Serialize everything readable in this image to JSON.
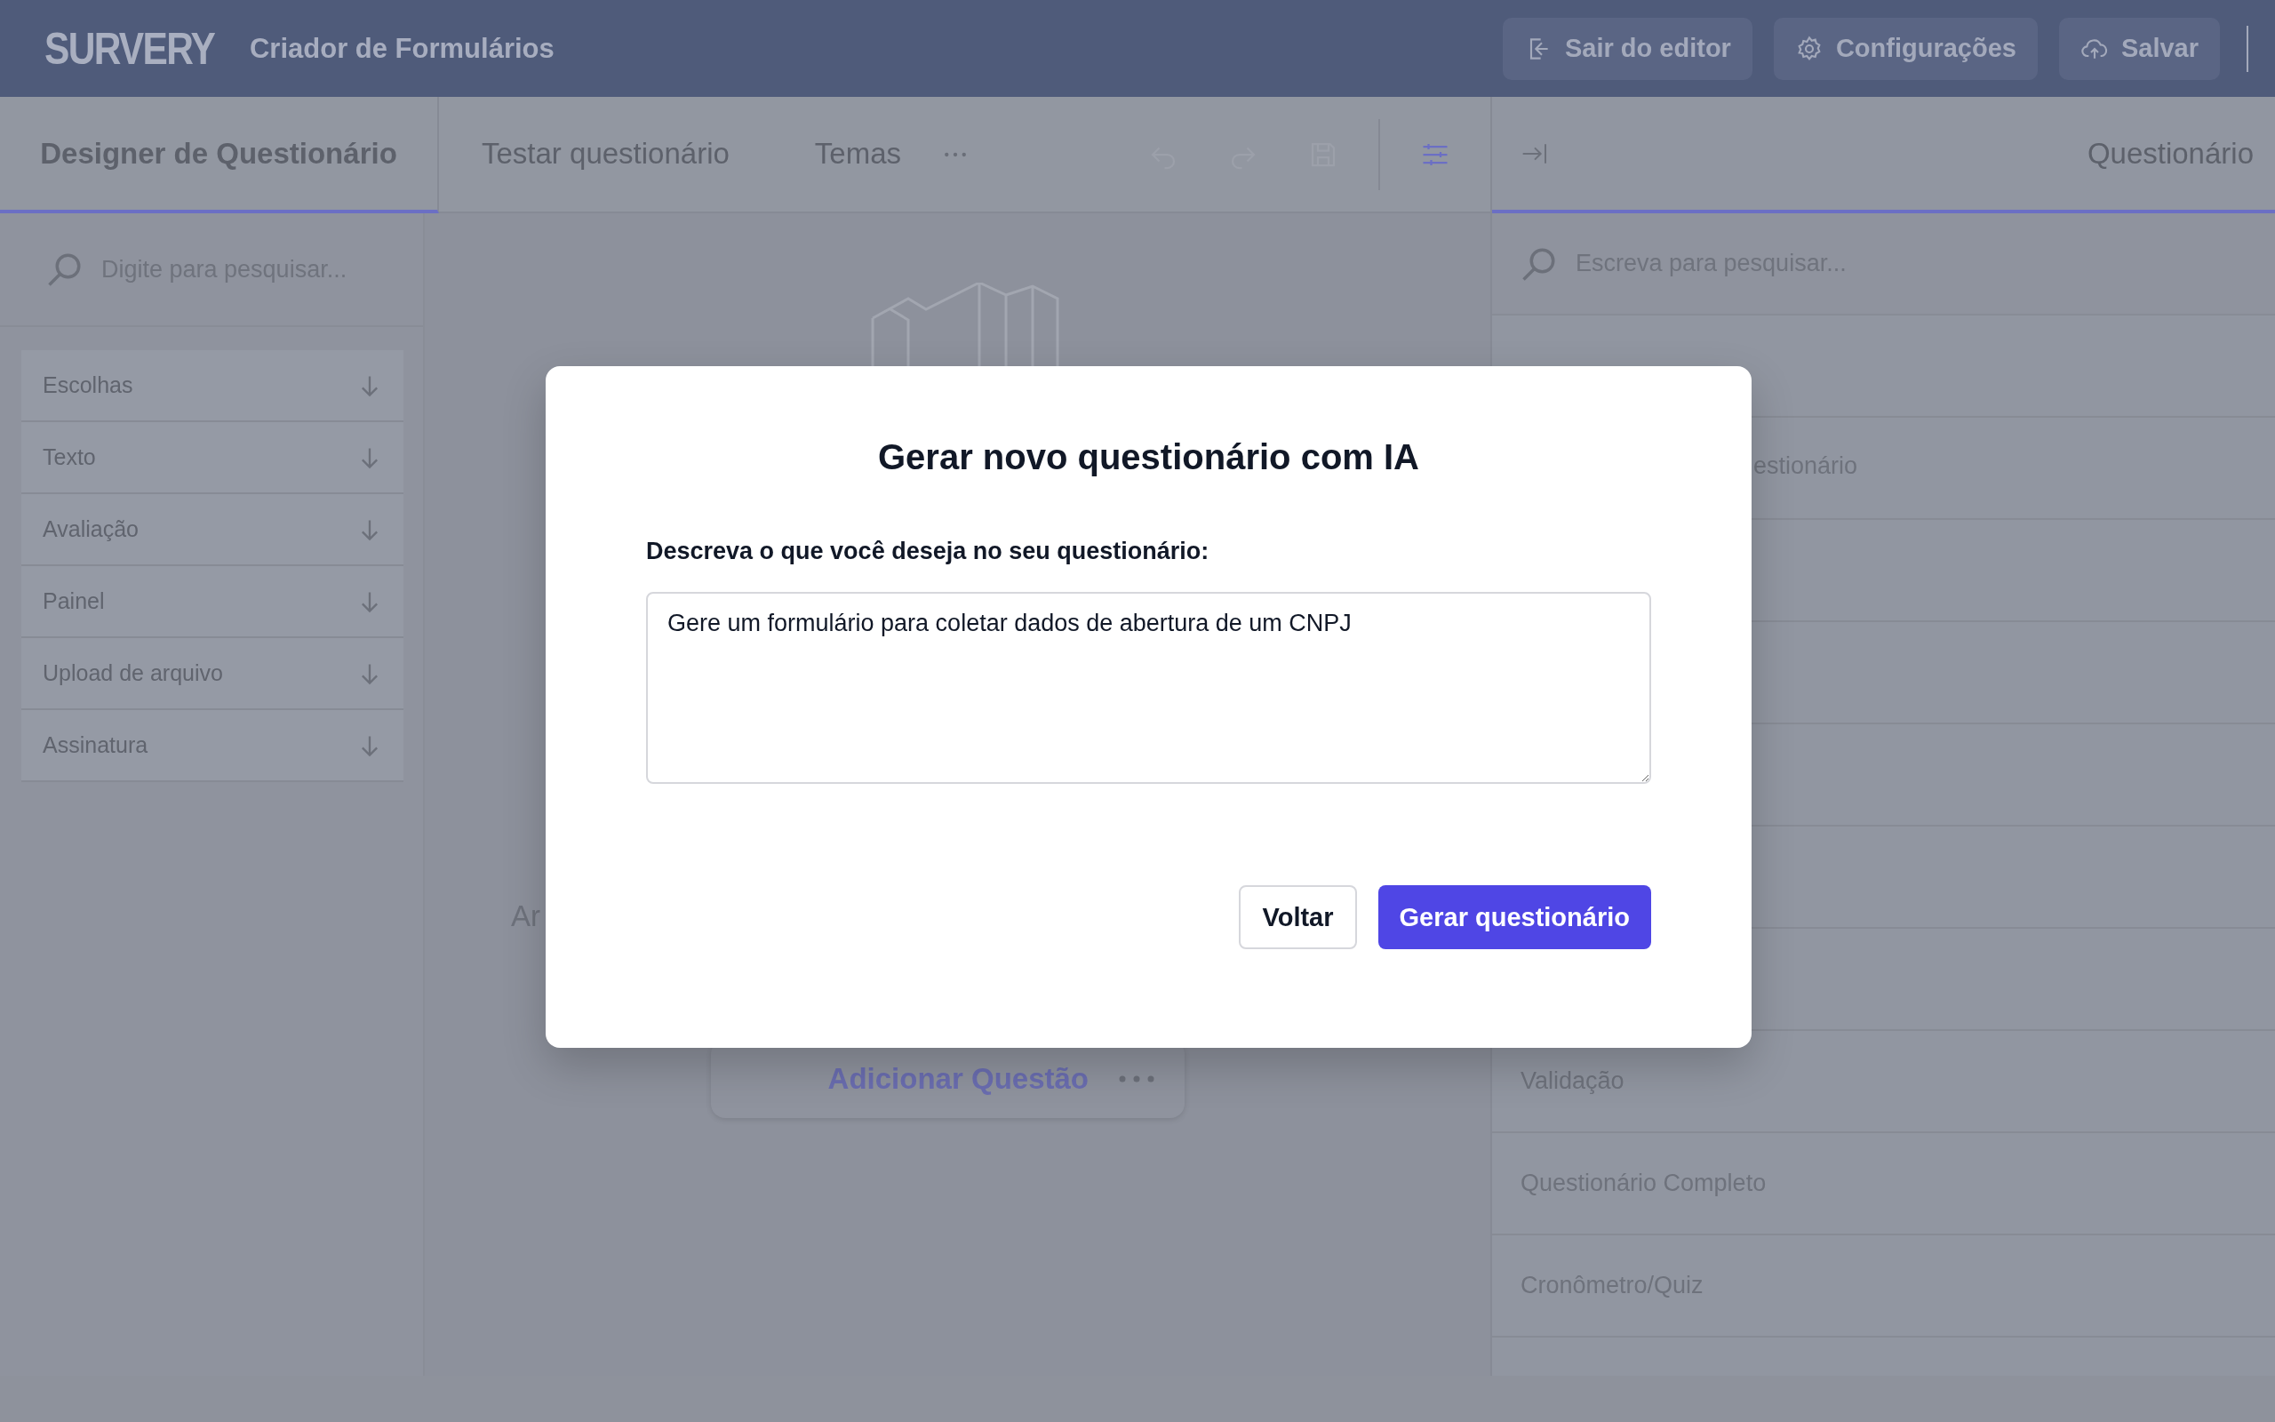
{
  "header": {
    "logo": "SURVERY",
    "title": "Criador de Formulários",
    "buttons": [
      {
        "kind": "exit",
        "label": "Sair do editor"
      },
      {
        "kind": "settings",
        "label": "Configurações"
      },
      {
        "kind": "save",
        "label": "Salvar"
      }
    ]
  },
  "tabs": [
    {
      "label": "Designer de Questionário",
      "selected": true
    },
    {
      "label": "Testar questionário",
      "selected": false
    },
    {
      "label": "Temas",
      "selected": false
    }
  ],
  "toolbar": [
    {
      "kind": "undo",
      "disabled": true,
      "active": false
    },
    {
      "kind": "redo",
      "disabled": true,
      "active": false
    },
    {
      "kind": "save",
      "disabled": true,
      "active": false
    },
    {
      "kind": "settings",
      "disabled": false,
      "active": true
    }
  ],
  "toolbox": {
    "search_placeholder": "Digite para pesquisar...",
    "categories": [
      {
        "label": "Escolhas",
        "expanded": false
      },
      {
        "label": "Texto",
        "expanded": false
      },
      {
        "label": "Avaliação",
        "expanded": false
      },
      {
        "label": "Painel",
        "expanded": false
      },
      {
        "label": "Upload de arquivo",
        "expanded": false
      },
      {
        "label": "Assinatura",
        "expanded": false
      }
    ]
  },
  "canvas": {
    "partial_text": "Ar",
    "add_button": "Adicionar Questão"
  },
  "property_panel": {
    "title": "Questionário",
    "search_placeholder": "Escreva para pesquisar...",
    "fragment_beside_dialog": "estionário",
    "rows": [
      {
        "label": "Validação"
      },
      {
        "label": "Questionário Completo"
      },
      {
        "label": "Cronômetro/Quiz"
      }
    ]
  },
  "dialog": {
    "title": "Gerar novo questionário com IA",
    "label": "Descreva o que você deseja no seu questionário:",
    "value": "Gere um formulário para coletar dados de abertura de um CNPJ",
    "buttons": [
      {
        "kind": "secondary",
        "label": "Voltar"
      },
      {
        "kind": "primary",
        "label": "Gerar questionário"
      }
    ]
  }
}
